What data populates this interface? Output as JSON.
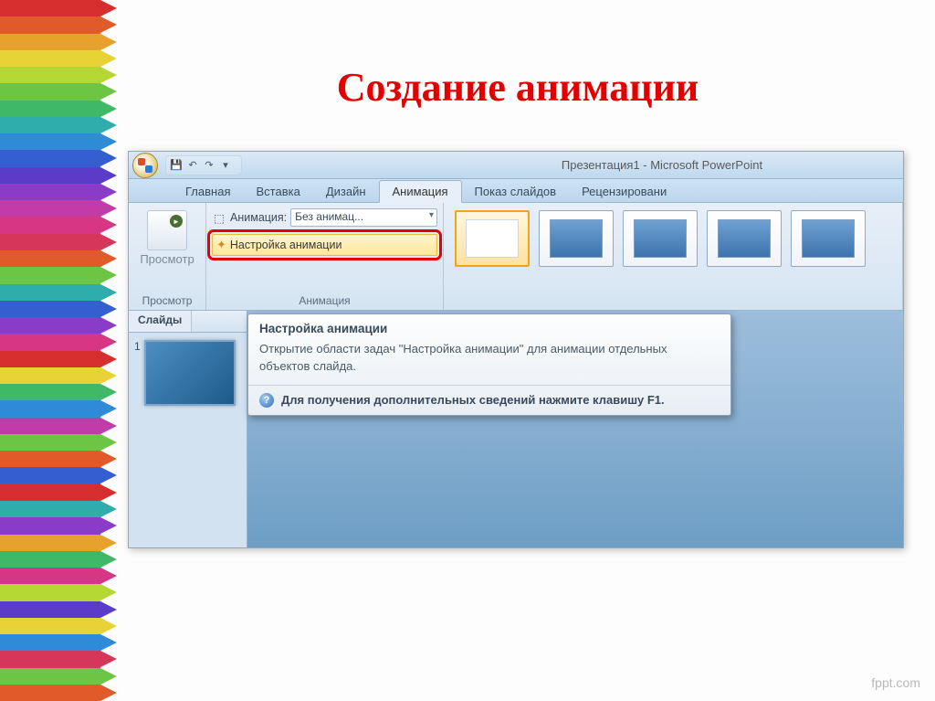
{
  "slide_title": "Создание анимации",
  "watermark": "fppt.com",
  "titlebar": "Презентация1 - Microsoft PowerPoint",
  "qat": {
    "save_tip": "💾",
    "undo_tip": "↶",
    "redo_tip": "↷"
  },
  "tabs": {
    "home": "Главная",
    "insert": "Вставка",
    "design": "Дизайн",
    "animation": "Анимация",
    "slideshow": "Показ слайдов",
    "review": "Рецензировани"
  },
  "ribbon": {
    "preview_group": {
      "button": "Просмотр",
      "label": "Просмотр"
    },
    "animation_group": {
      "animation_label": "Анимация:",
      "animation_value": "Без анимац...",
      "custom_anim": "Настройка анимации",
      "label": "Анимация"
    }
  },
  "sidebar": {
    "tab": "Слайды",
    "slide_number": "1"
  },
  "tooltip": {
    "title": "Настройка анимации",
    "body": "Открытие области задач \"Настройка анимации\" для анимации отдельных объектов слайда.",
    "help": "Для получения дополнительных сведений нажмите клавишу F1."
  },
  "pencil_colors": [
    "#d62e2e",
    "#e05a2a",
    "#e6a22d",
    "#e7d335",
    "#b5d733",
    "#6dc643",
    "#3fb867",
    "#2fadad",
    "#2f8ad7",
    "#355ed0",
    "#5a3cc9",
    "#8a3cc9",
    "#c23ca9",
    "#d63684",
    "#d6365a",
    "#e05a2a",
    "#6dc643",
    "#2fadad",
    "#355ed0",
    "#8a3cc9",
    "#d63684",
    "#d62e2e",
    "#e7d335",
    "#3fb867",
    "#2f8ad7",
    "#c23ca9",
    "#6dc643",
    "#e05a2a",
    "#355ed0",
    "#d62e2e",
    "#2fadad",
    "#8a3cc9",
    "#e6a22d",
    "#3fb867",
    "#d63684",
    "#b5d733",
    "#5a3cc9",
    "#e7d335",
    "#2f8ad7",
    "#d6365a",
    "#6dc643",
    "#e05a2a"
  ]
}
